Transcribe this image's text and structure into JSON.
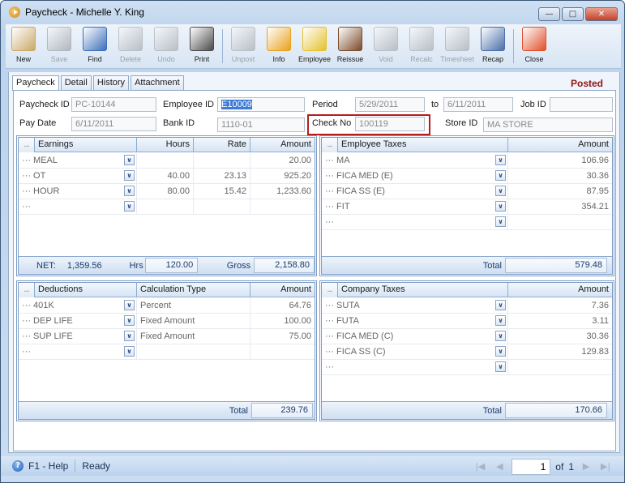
{
  "window": {
    "title": "Paycheck - Michelle Y. King",
    "minimize": "—",
    "restore": "□",
    "close": "✕"
  },
  "toolbar": [
    {
      "label": "New",
      "icon": "new-icon",
      "enabled": true,
      "color": "#c9a86a"
    },
    {
      "label": "Save",
      "icon": "save-icon",
      "enabled": false,
      "color": "#7a7a7a"
    },
    {
      "label": "Find",
      "icon": "binoculars-icon",
      "enabled": true,
      "color": "#3b6fb8"
    },
    {
      "label": "Delete",
      "icon": "trash-icon",
      "enabled": false,
      "color": "#8a8a8a"
    },
    {
      "label": "Undo",
      "icon": "undo-icon",
      "enabled": false,
      "color": "#8a8a8a"
    },
    {
      "label": "Print",
      "icon": "printer-icon",
      "enabled": true,
      "color": "#4a4a4a"
    },
    {
      "label": "Unpost",
      "icon": "unpost-icon",
      "enabled": false,
      "color": "#8a8a8a"
    },
    {
      "label": "Info",
      "icon": "info-card-icon",
      "enabled": true,
      "color": "#e8a21e"
    },
    {
      "label": "Employee",
      "icon": "employee-icon",
      "enabled": true,
      "color": "#e5c12c"
    },
    {
      "label": "Reissue",
      "icon": "reissue-icon",
      "enabled": true,
      "color": "#7a4a2a"
    },
    {
      "label": "Void",
      "icon": "void-icon",
      "enabled": false,
      "color": "#8a8a8a"
    },
    {
      "label": "Recalc",
      "icon": "calculator-icon",
      "enabled": false,
      "color": "#8a8a8a"
    },
    {
      "label": "Timesheet",
      "icon": "timesheet-icon",
      "enabled": false,
      "color": "#8a8a8a"
    },
    {
      "label": "Recap",
      "icon": "recap-icon",
      "enabled": true,
      "color": "#4a6ea8"
    },
    {
      "label": "Close",
      "icon": "close-window-icon",
      "enabled": true,
      "color": "#e0502a"
    }
  ],
  "tabs": [
    "Paycheck",
    "Detail",
    "History",
    "Attachment"
  ],
  "status_badge": "Posted",
  "form": {
    "paycheck_id_label": "Paycheck ID",
    "paycheck_id": "PC-10144",
    "employee_id_label": "Employee ID",
    "employee_id": "E10009",
    "period_label": "Period",
    "period_from": "5/29/2011",
    "to_label": "to",
    "period_to": "6/11/2011",
    "job_id_label": "Job ID",
    "job_id": "",
    "pay_date_label": "Pay Date",
    "pay_date": "6/11/2011",
    "bank_id_label": "Bank ID",
    "bank_id": "1110-01",
    "check_no_label": "Check No",
    "check_no": "100119",
    "store_id_label": "Store ID",
    "store_id": "MA STORE"
  },
  "earnings": {
    "headers": [
      "Earnings",
      "Hours",
      "Rate",
      "Amount"
    ],
    "rows": [
      {
        "name": "··· MEAL",
        "hours": "",
        "rate": "",
        "amount": "20.00"
      },
      {
        "name": "··· OT",
        "hours": "40.00",
        "rate": "23.13",
        "amount": "925.20"
      },
      {
        "name": "··· HOUR",
        "hours": "80.00",
        "rate": "15.42",
        "amount": "1,233.60"
      },
      {
        "name": "···",
        "hours": "",
        "rate": "",
        "amount": ""
      }
    ],
    "net_label": "NET:",
    "net": "1,359.56",
    "hrs_label": "Hrs",
    "hrs": "120.00",
    "gross_label": "Gross",
    "gross": "2,158.80"
  },
  "employee_taxes": {
    "headers": [
      "Employee Taxes",
      "Amount"
    ],
    "rows": [
      {
        "name": "··· MA",
        "amount": "106.96"
      },
      {
        "name": "··· FICA MED (E)",
        "amount": "30.36"
      },
      {
        "name": "··· FICA SS (E)",
        "amount": "87.95"
      },
      {
        "name": "··· FIT",
        "amount": "354.21"
      },
      {
        "name": "···",
        "amount": ""
      }
    ],
    "total_label": "Total",
    "total": "579.48"
  },
  "deductions": {
    "headers": [
      "Deductions",
      "Calculation Type",
      "Amount"
    ],
    "rows": [
      {
        "name": "··· 401K",
        "type": "Percent",
        "amount": "64.76"
      },
      {
        "name": "··· DEP LIFE",
        "type": "Fixed Amount",
        "amount": "100.00"
      },
      {
        "name": "··· SUP LIFE",
        "type": "Fixed Amount",
        "amount": "75.00"
      },
      {
        "name": "···",
        "type": "",
        "amount": ""
      }
    ],
    "total_label": "Total",
    "total": "239.76"
  },
  "company_taxes": {
    "headers": [
      "Company Taxes",
      "Amount"
    ],
    "rows": [
      {
        "name": "··· SUTA",
        "amount": "7.36"
      },
      {
        "name": "··· FUTA",
        "amount": "3.11"
      },
      {
        "name": "··· FICA MED (C)",
        "amount": "30.36"
      },
      {
        "name": "··· FICA SS (C)",
        "amount": "129.83"
      },
      {
        "name": "···",
        "amount": ""
      }
    ],
    "total_label": "Total",
    "total": "170.66"
  },
  "statusbar": {
    "help": "F1 - Help",
    "state": "Ready",
    "page": "1",
    "of_label": "of",
    "total_pages": "1"
  },
  "grid_dots": "...",
  "dropdown_glyph": "∨"
}
